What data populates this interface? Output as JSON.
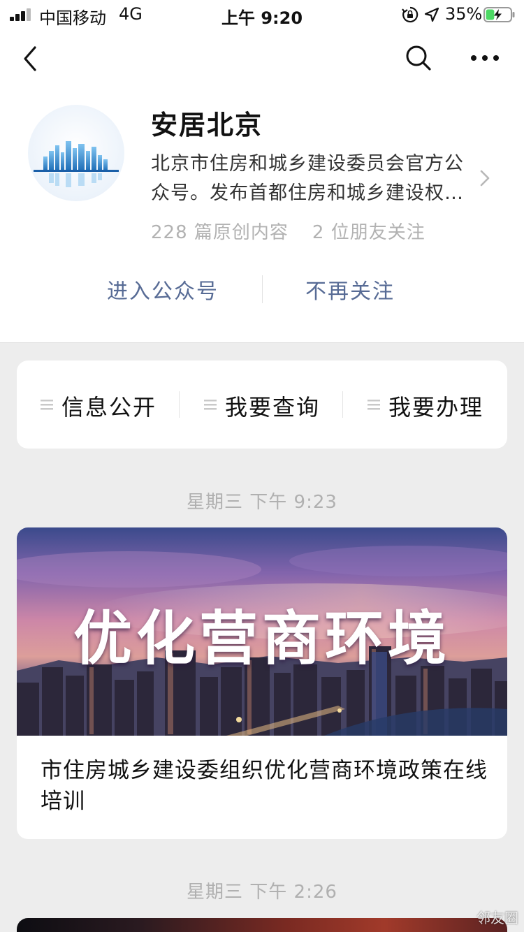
{
  "status_bar": {
    "carrier": "中国移动",
    "network": "4G",
    "time": "上午 9:20",
    "battery_percent": "35%",
    "battery_level": 0.35,
    "battery_color": "#4cd964"
  },
  "nav": {
    "back_icon": "chevron-left-icon",
    "search_icon": "search-icon",
    "more_icon": "more-dots-icon"
  },
  "account": {
    "name": "安居北京",
    "description": "北京市住房和城乡建设委员会官方公众号。发布首都住房和城乡建设权威信息",
    "stats": [
      "228 篇原创内容",
      "2 位朋友关注"
    ]
  },
  "actions": {
    "enter": "进入公众号",
    "unfollow": "不再关注",
    "link_color": "#576b95"
  },
  "menu": [
    {
      "label": "信息公开",
      "icon": "menu-lines-icon"
    },
    {
      "label": "我要查询",
      "icon": "menu-lines-icon"
    },
    {
      "label": "我要办理",
      "icon": "menu-lines-icon"
    }
  ],
  "messages": [
    {
      "time": "星期三 下午 9:23",
      "cover_text": "优化营商环境",
      "title": "市住房城乡建设委组织优化营商环境政策在线培训"
    },
    {
      "time": "星期三 下午 2:26"
    }
  ],
  "watermark": "邻友圈"
}
